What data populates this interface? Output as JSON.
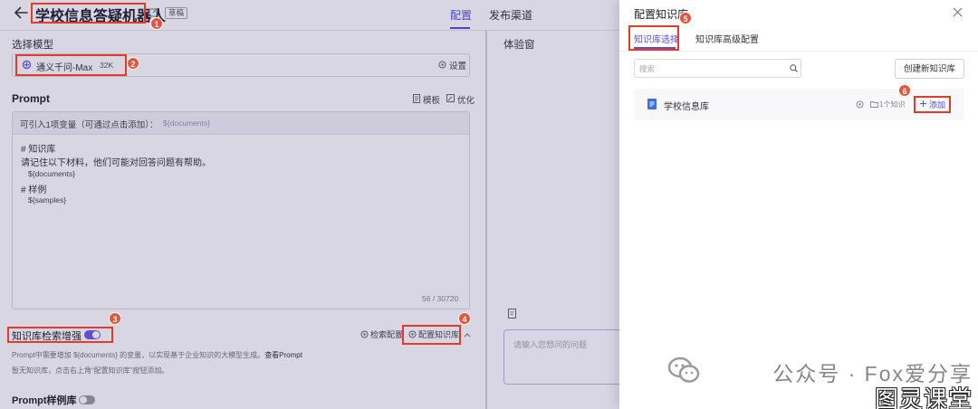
{
  "header": {
    "title": "学校信息答疑机器人",
    "status_badge": "草稿",
    "tabs": [
      {
        "label": "配置",
        "active": true
      },
      {
        "label": "发布渠道",
        "active": false
      }
    ]
  },
  "config": {
    "model_section_label": "选择模型",
    "model": {
      "name": "通义千问-Max",
      "context": "32K",
      "settings_label": "设置"
    },
    "prompt": {
      "heading": "Prompt",
      "template_label": "模板",
      "optimize_label": "优化",
      "variables_hint": "可引入1项变量（可通过点击添加）：",
      "variable": "${documents}",
      "lines": [
        {
          "text": "# 知识库",
          "kind": "heading"
        },
        {
          "text": "请记住以下材料，他们可能对回答问题有帮助。",
          "kind": "text"
        },
        {
          "text": "${documents}",
          "kind": "variable"
        },
        {
          "text": "# 样例",
          "kind": "heading"
        },
        {
          "text": "${samples}",
          "kind": "variable"
        }
      ],
      "counter": "56 / 30720"
    },
    "knowledge": {
      "label": "知识库检索增强",
      "enabled": true,
      "retrieval_config_label": "检索配置",
      "configure_kb_label": "配置知识库",
      "hint_prefix": "Prompt中需要增加 ",
      "hint_var": "${documents}",
      "hint_suffix": " 的变量，以实现基于企业知识的大模型生成。",
      "hint_link": "查看Prompt",
      "empty_note": "暂无知识库，点击右上角“配置知识库”按钮添加。"
    },
    "sample_library": {
      "label": "Prompt样例库",
      "enabled": false
    }
  },
  "preview": {
    "title": "体验窗",
    "input_placeholder": "请输入您想问的问题"
  },
  "drawer": {
    "title": "配置知识库",
    "tabs": [
      {
        "label": "知识库选择",
        "active": true
      },
      {
        "label": "知识库高级配置",
        "active": false
      }
    ],
    "search_placeholder": "搜索",
    "create_label": "创建新知识库",
    "items": [
      {
        "name": "学校信息库",
        "count": "1个知识",
        "add_label": "添加"
      }
    ]
  },
  "annotations": [
    "1",
    "2",
    "3",
    "4",
    "5",
    "6"
  ],
  "watermark": {
    "account": "公众号 · Fox爱分享",
    "stamp": "图灵课堂"
  },
  "icons": [
    "arrow-left-icon",
    "edit-icon",
    "model-logo-icon",
    "gear-icon",
    "template-icon",
    "optimize-icon",
    "chevron-up-icon",
    "chat-edit-icon",
    "close-icon",
    "search-icon",
    "document-icon",
    "folder-icon",
    "plus-icon",
    "wechat-icon"
  ],
  "colors": {
    "accent": "#5b4cdb",
    "annotation": "#e5553b",
    "highlight_box": "#e23b26",
    "doc_icon": "#3d6fe8"
  }
}
